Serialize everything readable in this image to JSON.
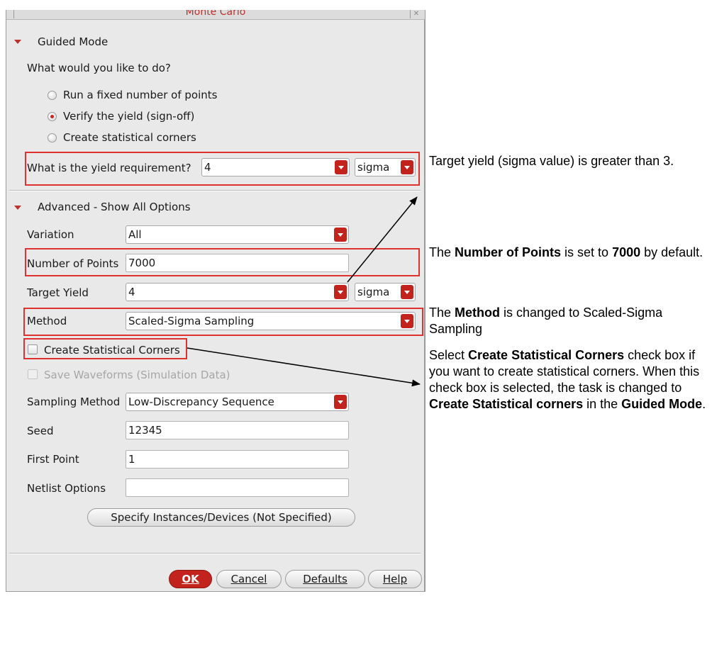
{
  "dialog": {
    "title": "Monte Carlo",
    "close_glyph": "✕"
  },
  "guided": {
    "header": "Guided Mode",
    "question": "What would you like to do?",
    "options": [
      {
        "label": "Run a fixed number of points",
        "selected": false
      },
      {
        "label": "Verify the yield (sign-off)",
        "selected": true
      },
      {
        "label": "Create statistical corners",
        "selected": false
      }
    ],
    "yield_label": "What is the yield requirement?",
    "yield_value": "4",
    "yield_unit": "sigma"
  },
  "advanced": {
    "header": "Advanced - Show All Options",
    "variation_label": "Variation",
    "variation_value": "All",
    "points_label": "Number of Points",
    "points_value": "7000",
    "target_label": "Target Yield",
    "target_value": "4",
    "target_unit": "sigma",
    "method_label": "Method",
    "method_value": "Scaled-Sigma Sampling",
    "create_corners_label": "Create Statistical Corners",
    "save_waveforms_label": "Save Waveforms (Simulation Data)",
    "sampling_label": "Sampling Method",
    "sampling_value": "Low-Discrepancy Sequence",
    "seed_label": "Seed",
    "seed_value": "12345",
    "first_point_label": "First Point",
    "first_point_value": "1",
    "netlist_label": "Netlist Options",
    "netlist_value": "",
    "specify_button": "Specify Instances/Devices (Not Specified)"
  },
  "buttons": {
    "ok": "OK",
    "cancel": "Cancel",
    "defaults": "Defaults",
    "help": "Help"
  },
  "annotations": {
    "yield": {
      "text": "Target yield (sigma value) is greater than 3."
    },
    "points": {
      "pre": "The ",
      "bold1": "Number of Points",
      "mid": " is set to ",
      "bold2": "7000",
      "post": " by default."
    },
    "method": {
      "pre": "The ",
      "bold1": "Method",
      "post": " is changed to Scaled-Sigma Sampling"
    },
    "corners": {
      "pre": "Select ",
      "bold1": "Create Statistical Corners",
      "mid": " check box if you want to create statistical corners. When this check box is selected, the task is changed to ",
      "bold2": "Create Statistical corners",
      "mid2": " in the ",
      "bold3": "Guided Mode",
      "post": "."
    }
  },
  "colors": {
    "accent": "#c3231d",
    "highlight": "#e03131",
    "panel_bg": "#e9e9e9"
  }
}
